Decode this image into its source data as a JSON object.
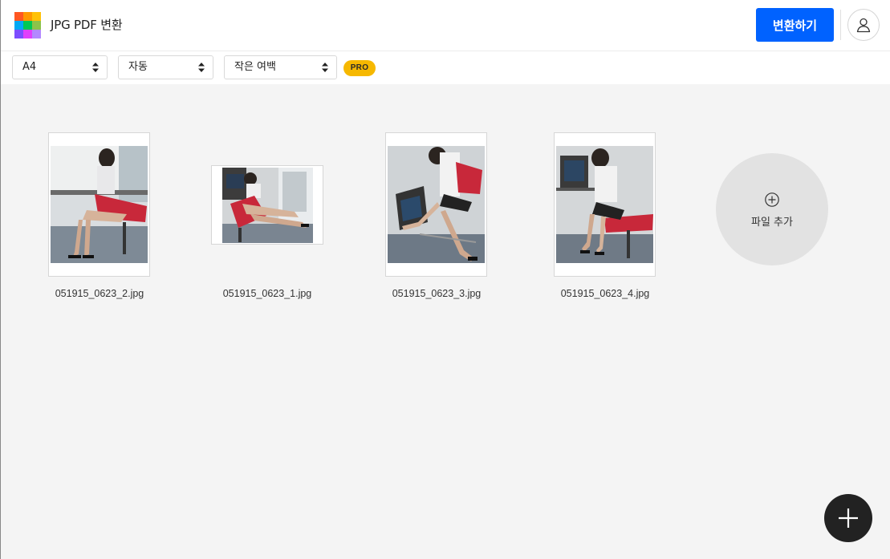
{
  "app": {
    "title": "JPG PDF 변환",
    "logo_colors": [
      "#ff5722",
      "#ff9800",
      "#ffc107",
      "#03a9f4",
      "#00c853",
      "#8bc34a",
      "#7c4dff",
      "#e040fb",
      "#b388ff"
    ]
  },
  "header": {
    "convert_label": "변환하기",
    "accent": "#0062ff"
  },
  "toolbar": {
    "page_size": "A4",
    "orientation": "자동",
    "margin": "작은 여백",
    "pro_badge": "PRO"
  },
  "files": [
    {
      "name": "051915_0623_2.jpg",
      "orientation": "portrait"
    },
    {
      "name": "051915_0623_1.jpg",
      "orientation": "landscape"
    },
    {
      "name": "051915_0623_3.jpg",
      "orientation": "portrait"
    },
    {
      "name": "051915_0623_4.jpg",
      "orientation": "portrait"
    }
  ],
  "add_file": {
    "label": "파일 추가"
  },
  "icons": {
    "user": "user-icon",
    "plus": "plus-circle-icon",
    "fab": "plus-icon",
    "select": "sort-arrows-icon"
  }
}
